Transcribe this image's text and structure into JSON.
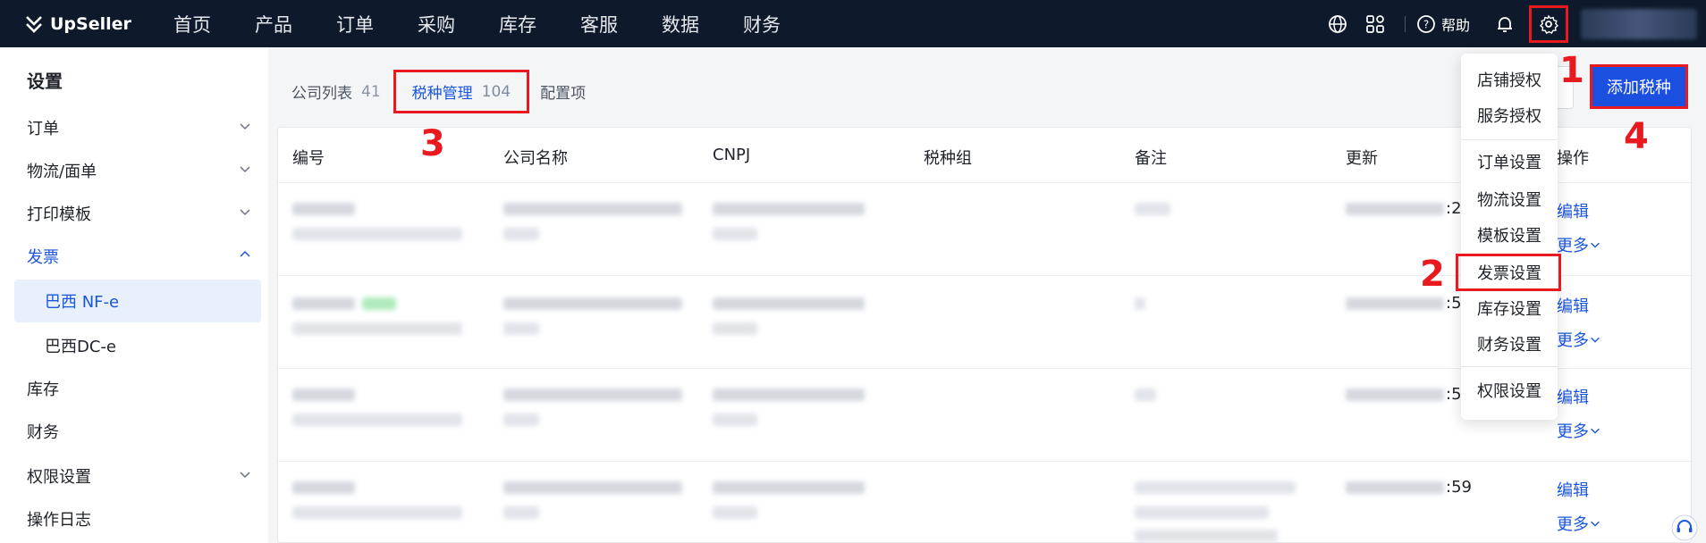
{
  "brand": {
    "name": "UpSeller"
  },
  "nav": {
    "items": [
      "首页",
      "产品",
      "订单",
      "采购",
      "库存",
      "客服",
      "数据",
      "财务"
    ]
  },
  "topbar": {
    "help_label": "帮助"
  },
  "sidebar": {
    "title": "设置",
    "items": [
      {
        "label": "订单",
        "has_chevron": true
      },
      {
        "label": "物流/面单",
        "has_chevron": true
      },
      {
        "label": "打印模板",
        "has_chevron": true
      },
      {
        "label": "发票",
        "expanded": true
      },
      {
        "label": "巴西 NF-e",
        "selected": true
      },
      {
        "label": "巴西DC-e"
      },
      {
        "label": "库存"
      },
      {
        "label": "财务"
      },
      {
        "label": "权限设置",
        "has_chevron": true
      },
      {
        "label": "操作日志"
      }
    ]
  },
  "tabs": [
    {
      "label": "公司列表",
      "count": "41"
    },
    {
      "label": "税种管理",
      "count": "104"
    },
    {
      "label": "配置项",
      "count": ""
    }
  ],
  "actions": {
    "add_label": "添加税种"
  },
  "table": {
    "columns": [
      "编号",
      "公司名称",
      "CNPJ",
      "税种组",
      "备注",
      "更新",
      "操作"
    ],
    "rows": [
      {
        "time_suffix": ":2",
        "edit": "编辑",
        "more": "更多"
      },
      {
        "time_suffix": ":5",
        "edit": "编辑",
        "more": "更多"
      },
      {
        "time_suffix": ":5",
        "edit": "编辑",
        "more": "更多"
      },
      {
        "time_suffix": ":59",
        "edit": "编辑",
        "more": "更多"
      }
    ]
  },
  "dropdown": {
    "items": [
      "店铺授权",
      "服务授权",
      "订单设置",
      "物流设置",
      "模板设置",
      "发票设置",
      "库存设置",
      "财务设置",
      "权限设置"
    ]
  },
  "annotations": [
    "1",
    "2",
    "3",
    "4"
  ],
  "colors": {
    "topbar": "#0e1a2b",
    "accent": "#1a56db",
    "highlight": "#e8191f",
    "button": "#1a4fe0"
  }
}
